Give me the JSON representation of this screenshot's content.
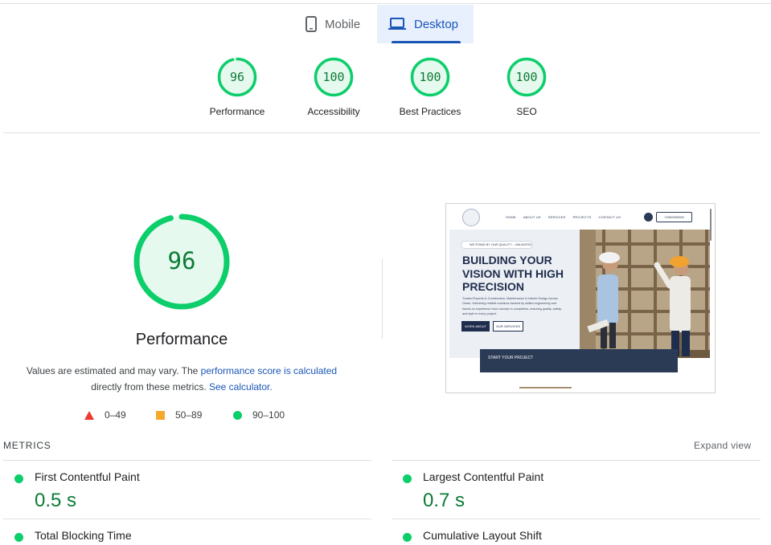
{
  "tabs": [
    {
      "label": "Mobile",
      "icon": "mobile-icon",
      "active": false
    },
    {
      "label": "Desktop",
      "icon": "laptop-icon",
      "active": true
    }
  ],
  "scores": [
    {
      "value": "96",
      "label": "Performance",
      "fraction": 0.96
    },
    {
      "value": "100",
      "label": "Accessibility",
      "fraction": 1.0
    },
    {
      "value": "100",
      "label": "Best Practices",
      "fraction": 1.0
    },
    {
      "value": "100",
      "label": "SEO",
      "fraction": 1.0
    }
  ],
  "main_gauge": {
    "value": "96",
    "fraction": 0.96,
    "title": "Performance"
  },
  "estimate": {
    "prefix": "Values are estimated and may vary. The ",
    "link1": "performance score is calculated",
    "middle": "directly from these metrics.",
    "link2": "See calculator."
  },
  "legend": [
    {
      "range": "0–49",
      "shape": "triangle",
      "color": "#eb3b2e"
    },
    {
      "range": "50–89",
      "shape": "square",
      "color": "#f4a92a"
    },
    {
      "range": "90–100",
      "shape": "circle",
      "color": "#0cce6b"
    }
  ],
  "preview": {
    "menu": [
      "HOME",
      "ABOUT US",
      "SERVICES",
      "PROJECTS",
      "CONTACT US"
    ],
    "phone": "+0000000000",
    "tag": "WE STAND BY OUR QUALITY – UNLIMITED",
    "headline": "BUILDING YOUR VISION WITH HIGH PRECISION",
    "paragraph": "Trusted Experts in Construction, Maintenance & Interior Design Across Oman. Delivering reliable solutions backed by skilled engineering and hands-on experience from concept to completion, ensuring quality, safety, and style in every project.",
    "button1": "WORK ABOUT",
    "button2": "OUR SERVICES",
    "band": "START YOUR PROJECT"
  },
  "metrics": {
    "title": "METRICS",
    "expand": "Expand view",
    "items": [
      {
        "name": "First Contentful Paint",
        "value": "0.5 s",
        "status_color": "#0cce6b"
      },
      {
        "name": "Largest Contentful Paint",
        "value": "0.7 s",
        "status_color": "#0cce6b"
      },
      {
        "name": "Total Blocking Time",
        "value": "",
        "status_color": "#0cce6b"
      },
      {
        "name": "Cumulative Layout Shift",
        "value": "",
        "status_color": "#0cce6b"
      }
    ]
  },
  "colors": {
    "pass": "#0cce6b",
    "pass_text": "#0c7b36",
    "accent": "#1a56b7"
  }
}
